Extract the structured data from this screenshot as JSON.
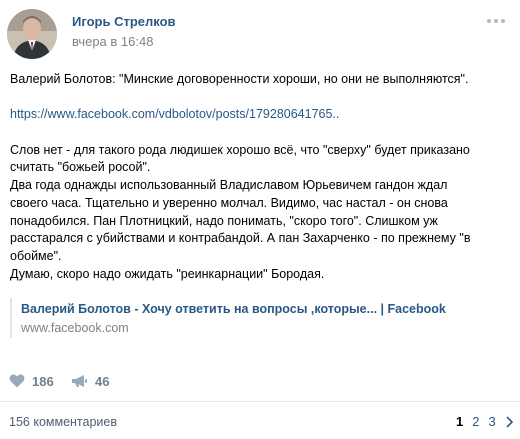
{
  "post": {
    "author": "Игорь Стрелков",
    "date": "вчера в 16:48",
    "lines": [
      "Валерий Болотов: \"Минские договоренности хороши, но они не выполняются\".",
      "",
      "https://www.facebook.com/vdbolotov/posts/179280641765..",
      "",
      "Слов нет - для такого рода людишек хорошо всё, что \"сверху\" будет приказано",
      "считать \"божьей росой\".",
      "Два года однажды использованный Владиславом Юрьевичем гандон ждал",
      "своего часа. Тщательно и уверенно молчал. Видимо, час настал - он снова",
      "понадобился. Пан Плотницкий, надо понимать, \"скоро того\". Слишком уж",
      "расстарался с убийствами и контрабандой. А пан Захарченко - по прежнему \"в",
      "обойме\".",
      "Думаю, скоро надо ожидать \"реинкарнации\" Бородая."
    ],
    "link": {
      "title": "Валерий Болотов - Хочу ответить на вопросы ,которые... | Facebook",
      "domain": "www.facebook.com"
    }
  },
  "actions": {
    "likes": "186",
    "reposts": "46"
  },
  "comments": {
    "count_label": "156 комментариев",
    "pages": [
      "1",
      "2",
      "3"
    ],
    "current_page": "1"
  },
  "colors": {
    "link": "#2a5885",
    "muted": "#828282",
    "action": "#6f7f8f"
  }
}
